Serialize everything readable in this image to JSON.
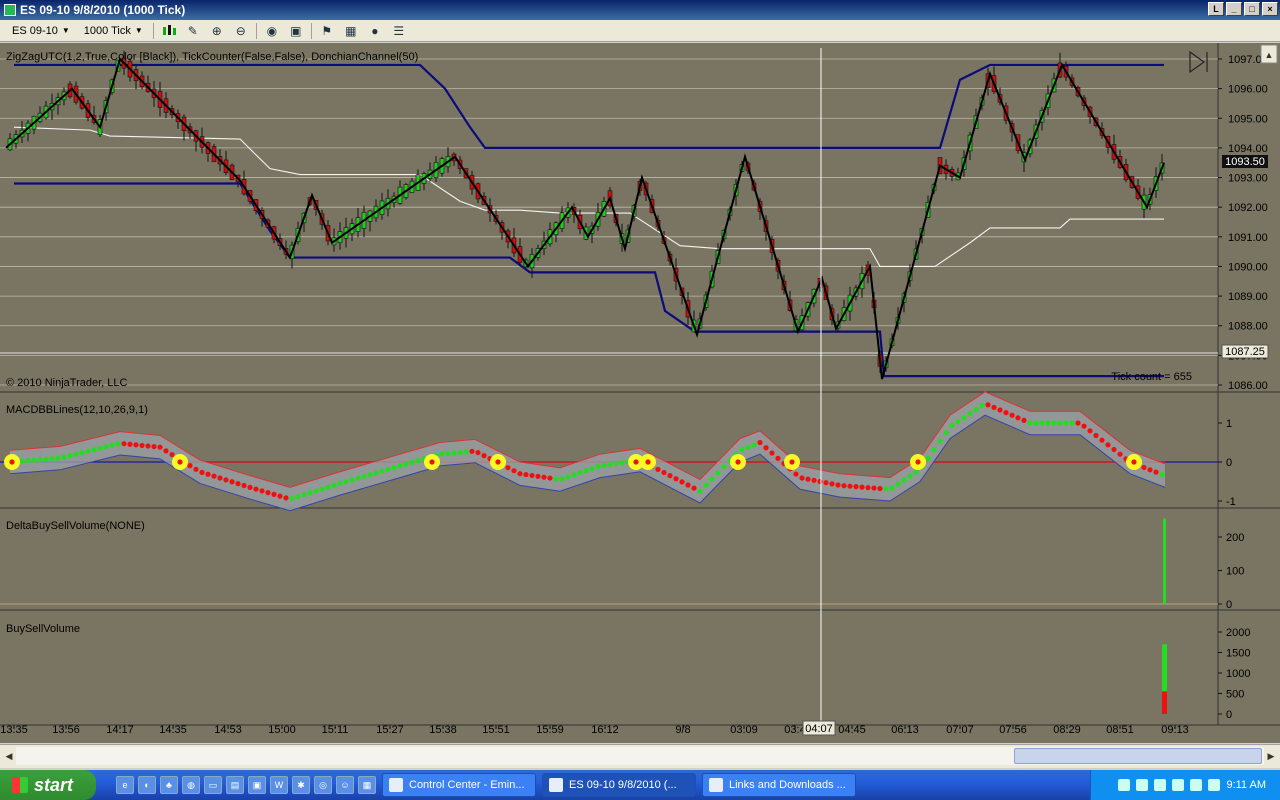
{
  "window": {
    "title": "ES 09-10  9/8/2010 (1000 Tick)"
  },
  "toolbar": {
    "instrument": "ES 09-10",
    "period": "1000 Tick"
  },
  "panels": {
    "price": {
      "label": "ZigZagUTC(1,2,True,Color [Black]), TickCounter(False,False), DonchianChannel(50)",
      "copyright": "© 2010 NinjaTrader, LLC",
      "tick_count": "Tick count = 655",
      "price_tag": "1093.50",
      "line_tag": "1087.25"
    },
    "macd": {
      "label": "MACDBBLines(12,10,26,9,1)"
    },
    "delta": {
      "label": "DeltaBuySellVolume(NONE)"
    },
    "bsv": {
      "label": "BuySellVolume"
    }
  },
  "cursor_time": "04:07",
  "colors": {
    "background": "#7a7562",
    "up": "#22cc22",
    "down": "#cc1111",
    "donchian": "#0b0b7a",
    "zigzag": "#000000",
    "mid": "#f4f4f4"
  },
  "chart_data": [
    {
      "type": "line",
      "panel": "price",
      "ylim": [
        1085.8,
        1097.4
      ],
      "y_ticks": [
        "1097.00",
        "1096.00",
        "1095.00",
        "1094.00",
        "1093.00",
        "1092.00",
        "1091.00",
        "1090.00",
        "1089.00",
        "1088.00",
        "1087.00",
        "1086.00"
      ],
      "x_ticks": [
        "13:35",
        "13:56",
        "14:17",
        "14:35",
        "14:53",
        "15:00",
        "15:11",
        "15:27",
        "15:38",
        "15:51",
        "15:59",
        "16:12",
        "9/8",
        "03:09",
        "03:4",
        "04:45",
        "06:13",
        "07:07",
        "07:56",
        "08:29",
        "08:51",
        "09:13"
      ],
      "last_price": 1093.5,
      "reference_line": 1087.25,
      "series": []
    },
    {
      "type": "line",
      "panel": "macd",
      "ylim": [
        -1,
        1
      ],
      "y_ticks": [
        "1",
        "0",
        "-1"
      ]
    },
    {
      "type": "bar",
      "panel": "delta",
      "y_ticks": [
        "200",
        "100",
        "0"
      ],
      "last_value": 255
    },
    {
      "type": "bar",
      "panel": "bsv",
      "y_ticks": [
        "2000",
        "1500",
        "1000",
        "500",
        "0"
      ],
      "buy": 1700,
      "sell": 550
    }
  ],
  "taskbar": {
    "start": "start",
    "tasks": [
      "Control Center - Emin...",
      "ES 09-10  9/8/2010 (...",
      "Links and Downloads ..."
    ],
    "clock": "9:11 AM"
  }
}
